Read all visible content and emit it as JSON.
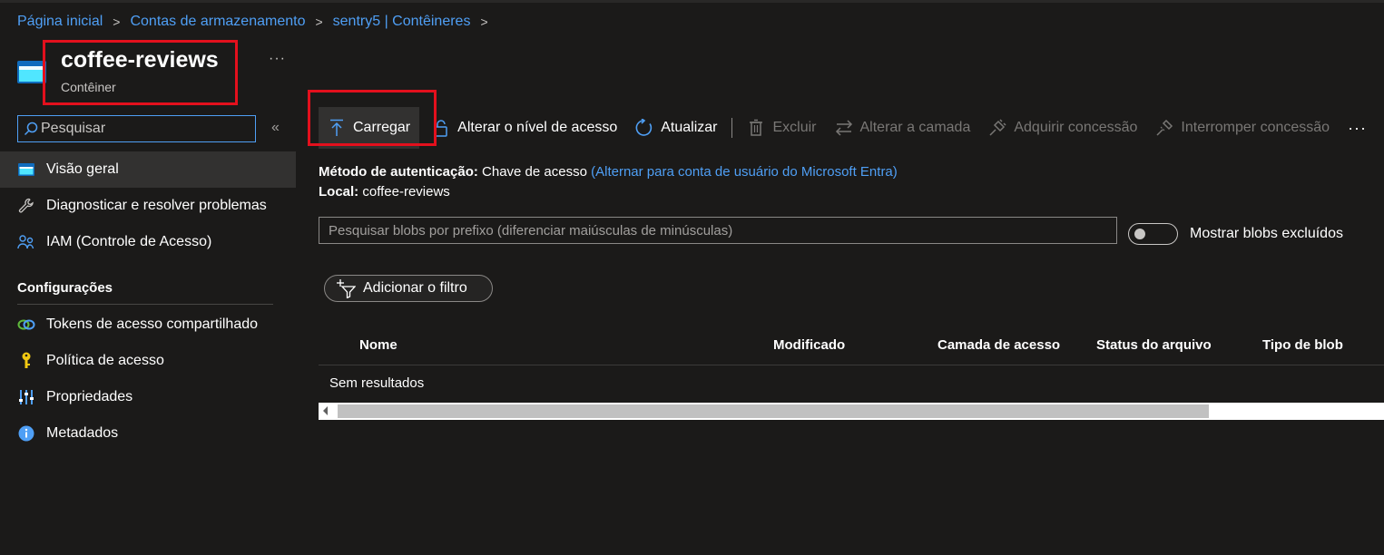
{
  "breadcrumb": {
    "items": [
      "Página inicial",
      "Contas de armazenamento",
      "sentry5 | Contêineres"
    ],
    "separator": ">"
  },
  "header": {
    "title": "coffee-reviews",
    "subtitle": "Contêiner",
    "more": "···"
  },
  "sidebar": {
    "search_placeholder": "Pesquisar",
    "collapse": "«",
    "items": [
      {
        "label": "Visão geral",
        "icon": "container-icon",
        "active": true
      },
      {
        "label": "Diagnosticar e resolver problemas",
        "icon": "wrench-icon"
      },
      {
        "label": "IAM (Controle de Acesso)",
        "icon": "people-icon"
      }
    ],
    "section_title": "Configurações",
    "settings_items": [
      {
        "label": "Tokens de acesso compartilhado",
        "icon": "link-icon"
      },
      {
        "label": "Política de acesso",
        "icon": "key-icon"
      },
      {
        "label": "Propriedades",
        "icon": "sliders-icon"
      },
      {
        "label": "Metadados",
        "icon": "info-icon"
      }
    ]
  },
  "toolbar": {
    "upload": "Carregar",
    "change_access": "Alterar o nível de acesso",
    "refresh": "Atualizar",
    "delete": "Excluir",
    "change_tier": "Alterar a camada",
    "acquire_lease": "Adquirir concessão",
    "break_lease": "Interromper concessão",
    "more": "···"
  },
  "info": {
    "auth_label": "Método de autenticação:",
    "auth_value": "Chave de acesso",
    "auth_link": "(Alternar para conta de usuário do Microsoft Entra)",
    "location_label": "Local:",
    "location_value": "coffee-reviews"
  },
  "blob_search": {
    "placeholder": "Pesquisar blobs por prefixo (diferenciar maiúsculas de minúsculas)"
  },
  "toggle": {
    "label": "Mostrar blobs excluídos",
    "on": false
  },
  "filter": {
    "label": "Adicionar o filtro"
  },
  "table": {
    "columns": [
      "Nome",
      "Modificado",
      "Camada de acesso",
      "Status do arquivo",
      "Tipo de blob"
    ],
    "empty_text": "Sem resultados"
  },
  "colors": {
    "background": "#1b1a19",
    "link": "#4f9ff5",
    "highlight": "#e3101d"
  }
}
